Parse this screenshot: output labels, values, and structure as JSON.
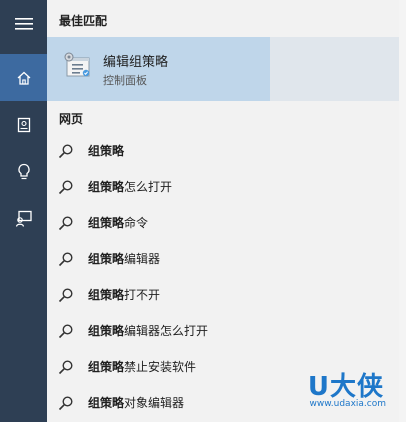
{
  "sections": {
    "best_match_title": "最佳匹配",
    "web_title": "网页"
  },
  "best_match": {
    "title": "编辑组策略",
    "subtitle": "控制面板",
    "icon": "group-policy-icon"
  },
  "rail": {
    "items": [
      {
        "name": "menu",
        "icon": "hamburger-icon"
      },
      {
        "name": "home",
        "icon": "home-icon"
      },
      {
        "name": "notebook",
        "icon": "notebook-icon"
      },
      {
        "name": "tips",
        "icon": "lightbulb-icon"
      },
      {
        "name": "feedback",
        "icon": "feedback-icon"
      }
    ]
  },
  "web_results": [
    {
      "bold": "组策略",
      "rest": ""
    },
    {
      "bold": "组策略",
      "rest": "怎么打开"
    },
    {
      "bold": "组策略",
      "rest": "命令"
    },
    {
      "bold": "组策略",
      "rest": "编辑器"
    },
    {
      "bold": "组策略",
      "rest": "打不开"
    },
    {
      "bold": "组策略",
      "rest": "编辑器怎么打开"
    },
    {
      "bold": "组策略",
      "rest": "禁止安装软件"
    },
    {
      "bold": "组策略",
      "rest": "对象编辑器"
    }
  ],
  "watermark": {
    "brand": "U大侠",
    "url": "www.udaxia.com"
  },
  "colors": {
    "rail_bg": "#2e3f54",
    "rail_active": "#3d6aa0",
    "best_match_bg": "#bfd6ea",
    "watermark": "#1e77c9"
  }
}
